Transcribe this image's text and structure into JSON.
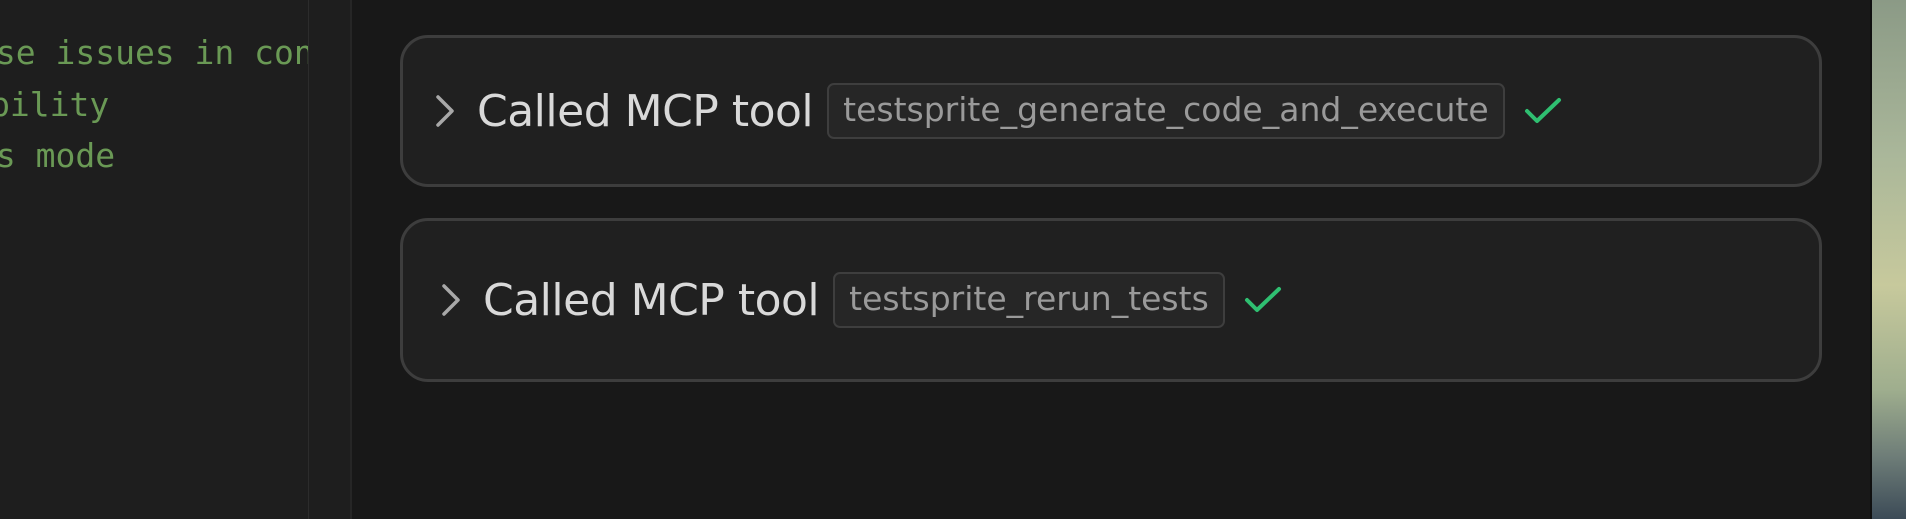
{
  "editor": {
    "lines": [
      "use issues in cont",
      "bility",
      "ss mode"
    ]
  },
  "tool_calls": [
    {
      "label": "Called MCP tool",
      "tool_name": "testsprite_generate_code_and_execute",
      "status": "success",
      "expand_icon": "chevron-right-icon",
      "status_icon": "checkmark-icon"
    },
    {
      "label": "Called MCP tool",
      "tool_name": "testsprite_rerun_tests",
      "status": "success",
      "expand_icon": "chevron-right-icon",
      "status_icon": "checkmark-icon"
    }
  ],
  "colors": {
    "success": "#2fbf71",
    "comment_text": "#6a9955",
    "panel_bg": "#181818",
    "card_bg": "#202020",
    "card_border": "#3d3d3d"
  }
}
